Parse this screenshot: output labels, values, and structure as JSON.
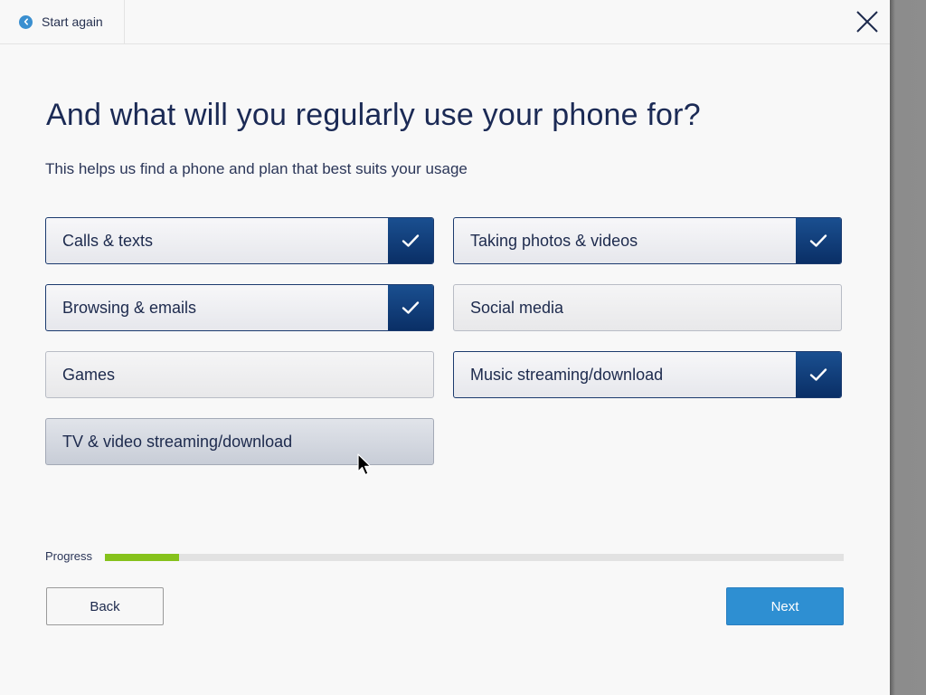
{
  "header": {
    "start_again_label": "Start again",
    "back_icon": "chevron-left-icon",
    "close_icon": "close-icon"
  },
  "main": {
    "title": "And what will you regularly use your phone for?",
    "subtitle": "This helps us find a phone and plan that best suits your usage",
    "options": [
      {
        "label": "Calls & texts",
        "selected": true
      },
      {
        "label": "Taking photos & videos",
        "selected": true
      },
      {
        "label": "Browsing & emails",
        "selected": true
      },
      {
        "label": "Social media",
        "selected": false
      },
      {
        "label": "Games",
        "selected": false
      },
      {
        "label": "Music streaming/download",
        "selected": true
      },
      {
        "label": "TV & video streaming/download",
        "selected": false,
        "hovered": true
      }
    ]
  },
  "progress": {
    "label": "Progress",
    "value_fraction": 0.1
  },
  "footer": {
    "back_label": "Back",
    "next_label": "Next"
  },
  "colors": {
    "accent_blue": "#2e8fd2",
    "selected_navy": "#0a2f66",
    "progress_green": "#86c21c",
    "heading_text": "#1b2a55"
  }
}
